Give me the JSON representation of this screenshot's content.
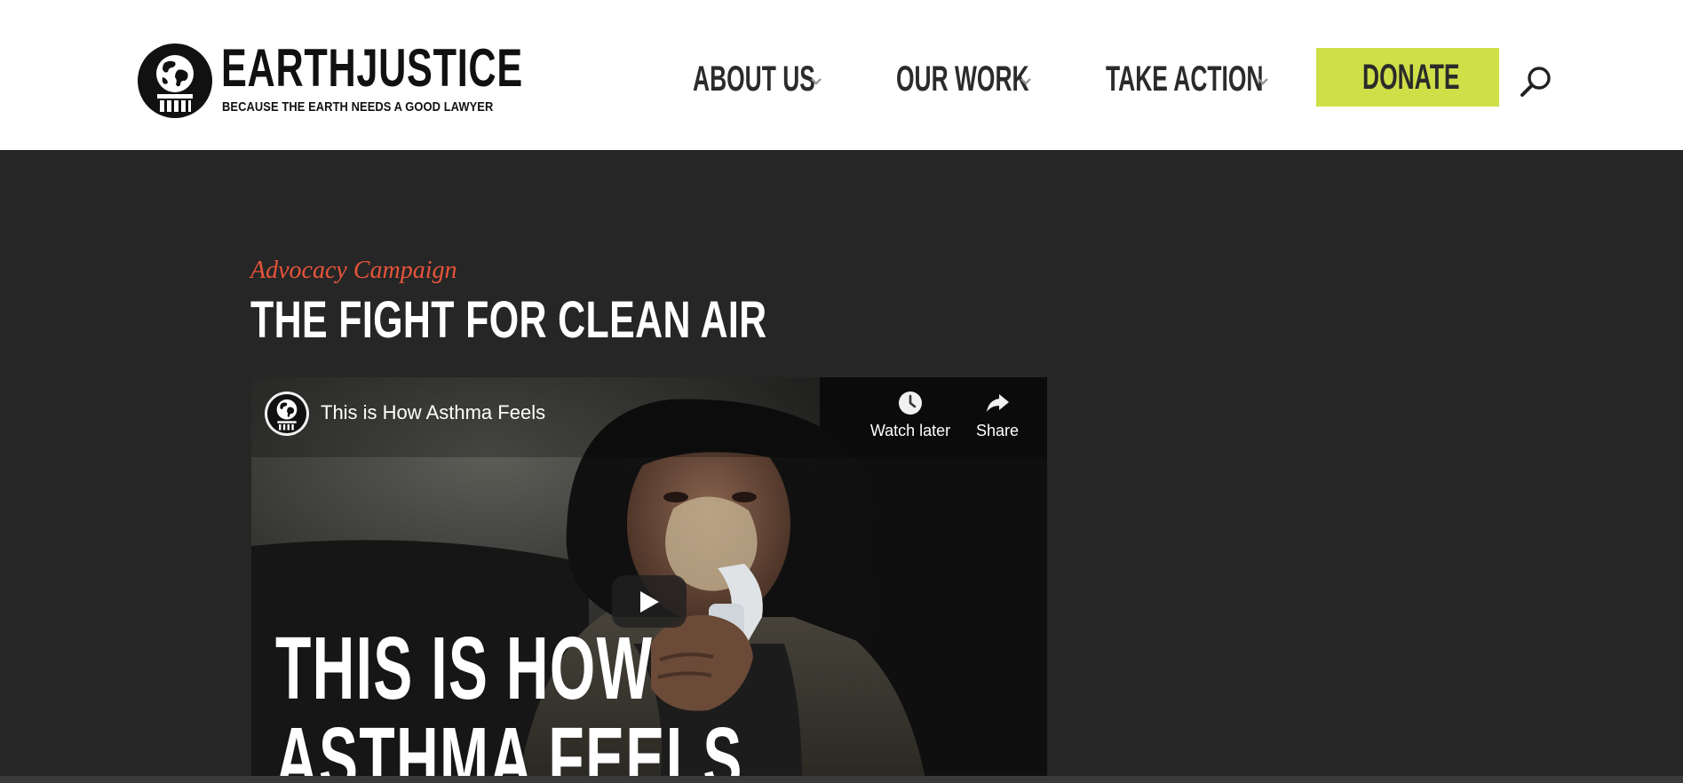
{
  "header": {
    "logo": {
      "wordmark": "EARTHJUSTICE",
      "tagline": "BECAUSE THE EARTH NEEDS A GOOD LAWYER",
      "icon": "globe-pillar-icon"
    },
    "nav": [
      {
        "label": "ABOUT US",
        "icon": "chevron-down-icon"
      },
      {
        "label": "OUR WORK",
        "icon": "chevron-down-icon"
      },
      {
        "label": "TAKE ACTION",
        "icon": "chevron-down-icon"
      }
    ],
    "donate_label": "DONATE",
    "search_icon": "search-icon"
  },
  "hero": {
    "eyebrow": "Advocacy Campaign",
    "title": "THE FIGHT FOR CLEAN AIR"
  },
  "video": {
    "title": "This is How Asthma Feels",
    "watch_later_label": "Watch later",
    "share_label": "Share",
    "overlay_lines": [
      "THIS IS HOW",
      "ASTHMA FEELS"
    ],
    "icons": {
      "watch_later": "clock-icon",
      "share": "share-arrow-icon",
      "play": "play-icon"
    }
  },
  "colors": {
    "header_bg": "#ffffff",
    "page_bg": "#262626",
    "donate_bg": "#cfdf47",
    "eyebrow": "#e8543a",
    "nav_text": "#2b2b2b"
  }
}
